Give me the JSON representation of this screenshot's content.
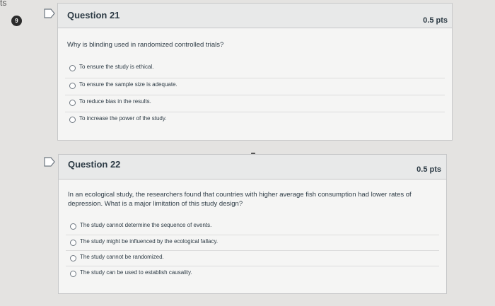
{
  "edge_fragment": "ts",
  "question_badge": "9",
  "questions": [
    {
      "title": "Question 21",
      "points": "0.5 pts",
      "text": "Why is blinding used in randomized controlled trials?",
      "options": [
        "To ensure the study is ethical.",
        "To ensure the sample size is adequate.",
        "To reduce bias in the results.",
        "To increase the power of the study."
      ]
    },
    {
      "title": "Question 22",
      "points": "0.5 pts",
      "text": "In an ecological study, the researchers found that countries with higher average fish consumption had lower rates of depression. What is a major limitation of this study design?",
      "options": [
        "The study cannot determine the sequence of events.",
        "The study might be influenced by the ecological fallacy.",
        "The study cannot be randomized.",
        "The study can be used to establish causality."
      ]
    }
  ]
}
